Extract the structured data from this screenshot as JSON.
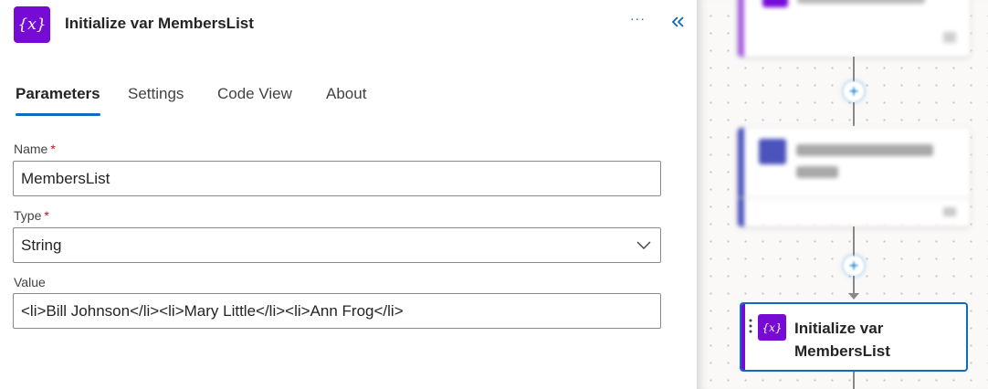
{
  "panel": {
    "title": "Initialize var MembersList",
    "action_icon_text": "{x}",
    "more_label": "···",
    "collapse_icon": "double-chevron-left-icon"
  },
  "tabs": [
    {
      "label": "Parameters",
      "active": true
    },
    {
      "label": "Settings",
      "active": false
    },
    {
      "label": "Code View",
      "active": false
    },
    {
      "label": "About",
      "active": false
    }
  ],
  "fields": {
    "name": {
      "label": "Name",
      "required_mark": "*",
      "value": "MembersList"
    },
    "type": {
      "label": "Type",
      "required_mark": "*",
      "value": "String"
    },
    "value": {
      "label": "Value",
      "value": "<li>Bill Johnson</li><li>Mary Little</li><li>Ann Frog</li>"
    }
  },
  "canvas": {
    "selected_card": {
      "icon_text": "{x}",
      "title": "Initialize var MembersList"
    }
  },
  "colors": {
    "accent_blue": "#0f6cbd",
    "variable_purple": "#770bd6",
    "teams_purple": "#4b53bc",
    "required_red": "#c50f1f"
  }
}
